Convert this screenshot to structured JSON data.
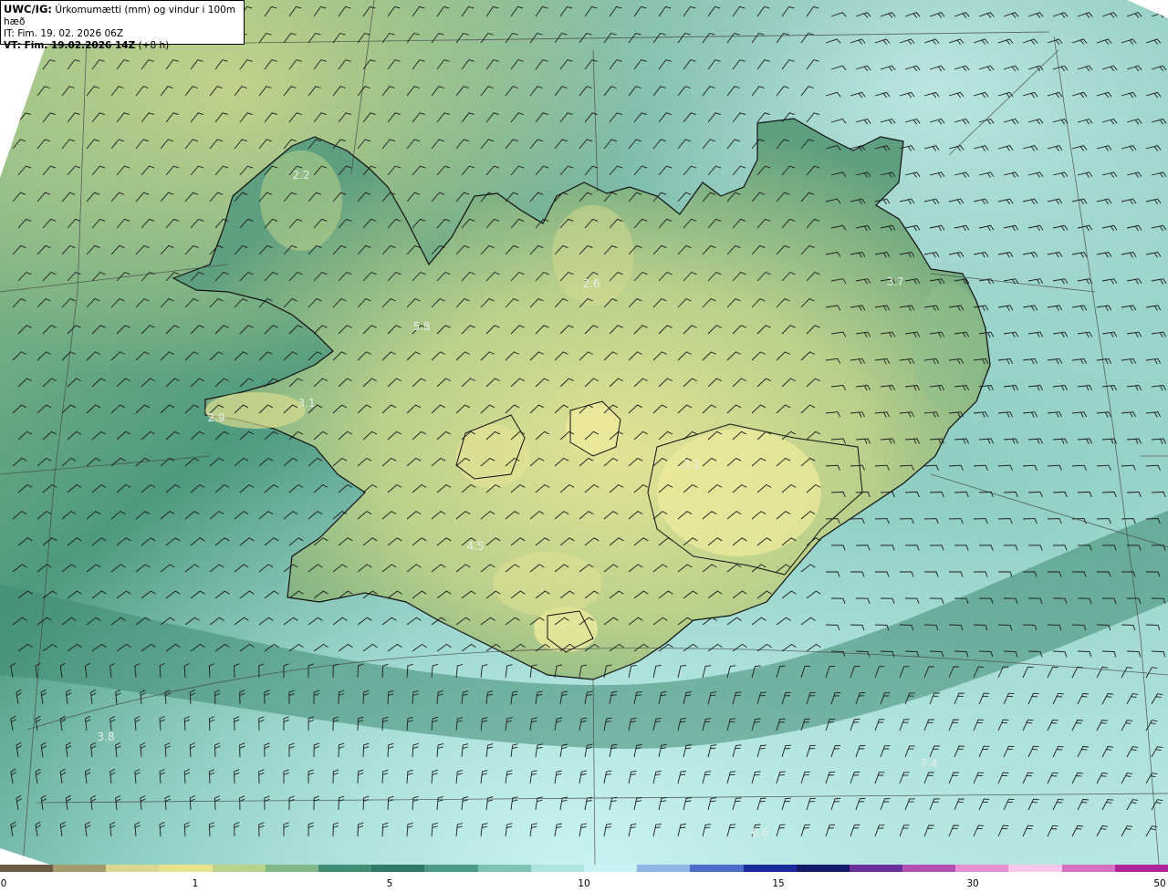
{
  "header": {
    "product": "UWC/IG:",
    "title": "Úrkomumætti (mm) og vindur i 100m hæð",
    "init_time": "IT: Fim. 19. 02. 2026 06Z",
    "valid_prefix": "VT: Fim. 19.02.2026 14Z",
    "valid_suffix": "(+8 h)"
  },
  "labels": [
    "5.8",
    "3.1",
    "2.9",
    "4.5",
    "3.8",
    "3.7",
    "7.4",
    "6.6",
    "2.6",
    "3.2",
    "2.2"
  ],
  "colorbar": {
    "ticks": [
      "0",
      "1",
      "5",
      "10",
      "15",
      "30",
      "50"
    ],
    "colors": [
      "#6b5a44",
      "#a59a6d",
      "#d9d88f",
      "#e8e48e",
      "#b9d38d",
      "#7fb987",
      "#3f8d72",
      "#2e7a66",
      "#4a9a86",
      "#7ec3b6",
      "#aee3e0",
      "#c8f2f3",
      "#8fb8e6",
      "#4a6cc7",
      "#1a2a9a",
      "#141a6a",
      "#6a2f9a",
      "#b34fb3",
      "#e58fd0",
      "#f7c6e8",
      "#d66fc0",
      "#b0249a"
    ]
  },
  "map_colors": {
    "sea_light": "#b6e4de",
    "sea_mid": "#6fb7a4",
    "green_dark": "#2f7a62",
    "land_yellow": "#cfd88c",
    "land_olive": "#9fbf82"
  }
}
